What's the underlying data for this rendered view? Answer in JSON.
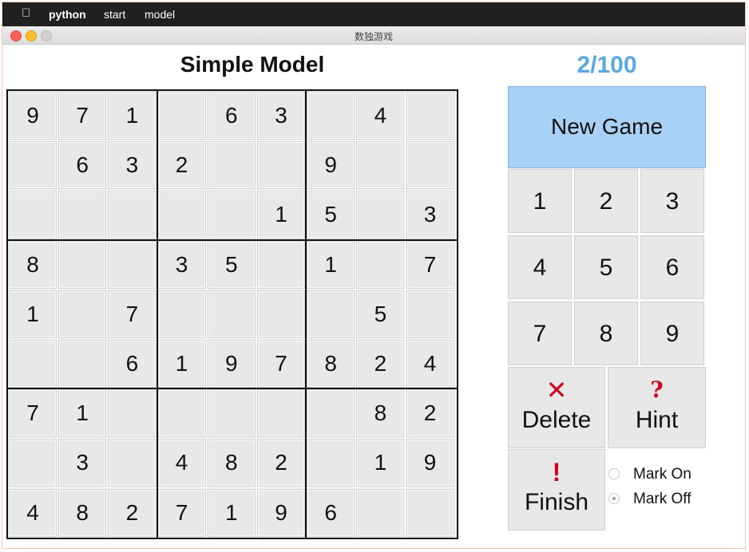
{
  "menubar": {
    "items": [
      "python",
      "start",
      "model"
    ]
  },
  "window": {
    "title": "数独游戏"
  },
  "header": {
    "title": "Simple Model",
    "progress": "2/100"
  },
  "board": {
    "rows": [
      [
        "9",
        "7",
        "1",
        "",
        "6",
        "3",
        "",
        "4",
        ""
      ],
      [
        "",
        "6",
        "3",
        "2",
        "",
        "",
        "9",
        "",
        ""
      ],
      [
        "",
        "",
        "",
        "",
        "",
        "1",
        "5",
        "",
        "3"
      ],
      [
        "8",
        "",
        "",
        "3",
        "5",
        "",
        "1",
        "",
        "7"
      ],
      [
        "1",
        "",
        "7",
        "",
        "",
        "",
        "",
        "5",
        ""
      ],
      [
        "",
        "",
        "6",
        "1",
        "9",
        "7",
        "8",
        "2",
        "4"
      ],
      [
        "7",
        "1",
        "",
        "",
        "",
        "",
        "",
        "8",
        "2"
      ],
      [
        "",
        "3",
        "",
        "4",
        "8",
        "2",
        "",
        "1",
        "9"
      ],
      [
        "4",
        "8",
        "2",
        "7",
        "1",
        "9",
        "6",
        "",
        ""
      ]
    ]
  },
  "controls": {
    "new_game": "New Game",
    "keypad": [
      "1",
      "2",
      "3",
      "4",
      "5",
      "6",
      "7",
      "8",
      "9"
    ],
    "delete_label": "Delete",
    "delete_icon": "✕",
    "hint_label": "Hint",
    "hint_icon": "?",
    "finish_label": "Finish",
    "finish_icon": "!",
    "mark_on": "Mark On",
    "mark_off": "Mark Off",
    "mark_selected": "Mark Off"
  },
  "colors": {
    "accent": "#5aa8e3",
    "new_game_bg": "#a9d0f5",
    "icon_red": "#d0021b"
  }
}
